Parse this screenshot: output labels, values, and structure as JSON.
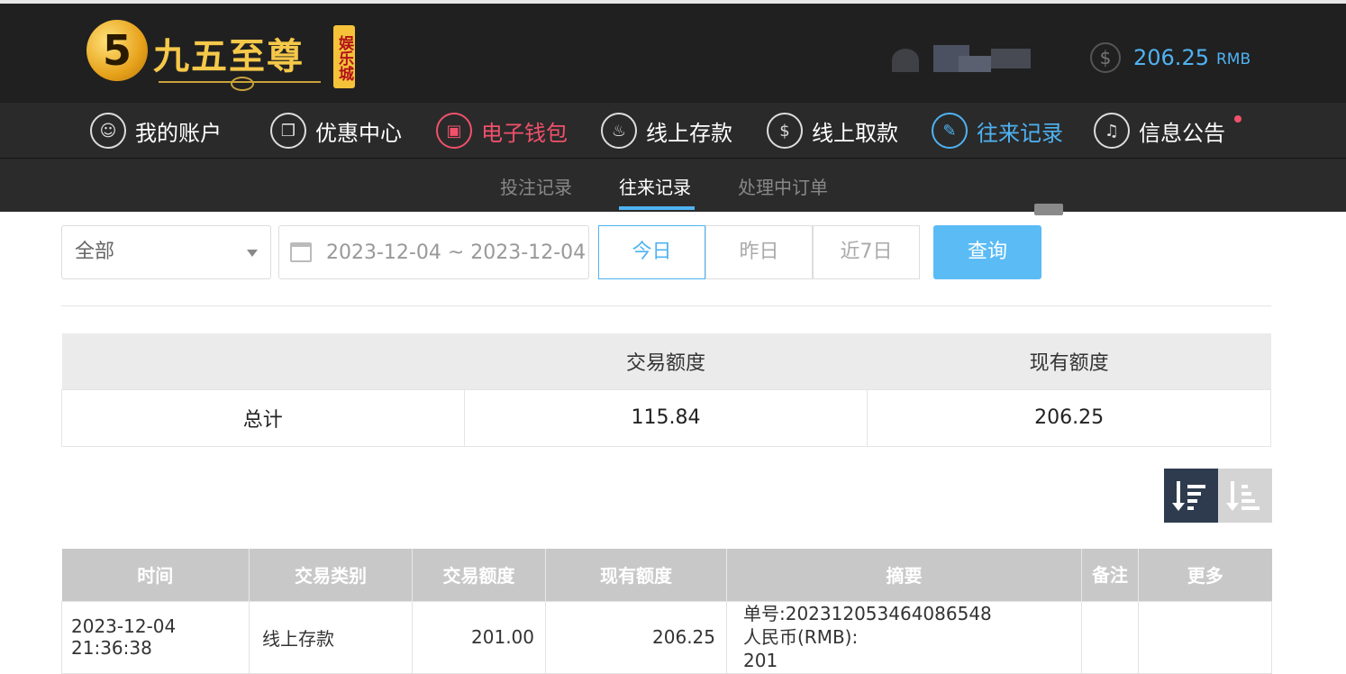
{
  "header": {
    "logo_badge": "5",
    "logo_text": "九五至尊",
    "logo_tag": "娱乐城",
    "balance_value": "206.25",
    "balance_unit": "RMB",
    "coin_symbol": "$"
  },
  "nav": {
    "items": [
      {
        "label": "我的账户",
        "icon": "user-icon",
        "glyph": "☺"
      },
      {
        "label": "优惠中心",
        "icon": "gift-icon",
        "glyph": "❒"
      },
      {
        "label": "电子钱包",
        "icon": "wallet-icon",
        "glyph": "▣"
      },
      {
        "label": "线上存款",
        "icon": "deposit-icon",
        "glyph": "♨"
      },
      {
        "label": "线上取款",
        "icon": "withdraw-icon",
        "glyph": "$"
      },
      {
        "label": "往来记录",
        "icon": "records-icon",
        "glyph": "✎"
      },
      {
        "label": "信息公告",
        "icon": "bell-icon",
        "glyph": "♫"
      }
    ],
    "active_index": 5,
    "highlight_index": 2
  },
  "subnav": {
    "items": [
      "投注记录",
      "往来记录",
      "处理中订单"
    ],
    "active_index": 1
  },
  "filters": {
    "type_select": "全部",
    "date_range": "2023-12-04 ~ 2023-12-04",
    "quick": [
      "今日",
      "昨日",
      "近7日"
    ],
    "quick_active_index": 0,
    "query_label": "查询"
  },
  "summary": {
    "headers": [
      "",
      "交易额度",
      "现有额度"
    ],
    "row": [
      "总计",
      "115.84",
      "206.25"
    ]
  },
  "sort": {
    "active": "desc"
  },
  "table": {
    "headers": [
      "时间",
      "交易类别",
      "交易额度",
      "现有额度",
      "摘要",
      "备注",
      "更多"
    ],
    "rows": [
      {
        "time": "2023-12-04 21:36:38",
        "type": "线上存款",
        "amount": "201.00",
        "balance": "206.25",
        "summary_lines": [
          "单号:202312053464086548",
          "人民币(RMB):",
          "201"
        ],
        "remark": "",
        "more": ""
      }
    ]
  },
  "colors": {
    "accent": "#4fb3f2",
    "highlight": "#f0516b",
    "header_bg": "#202020"
  }
}
